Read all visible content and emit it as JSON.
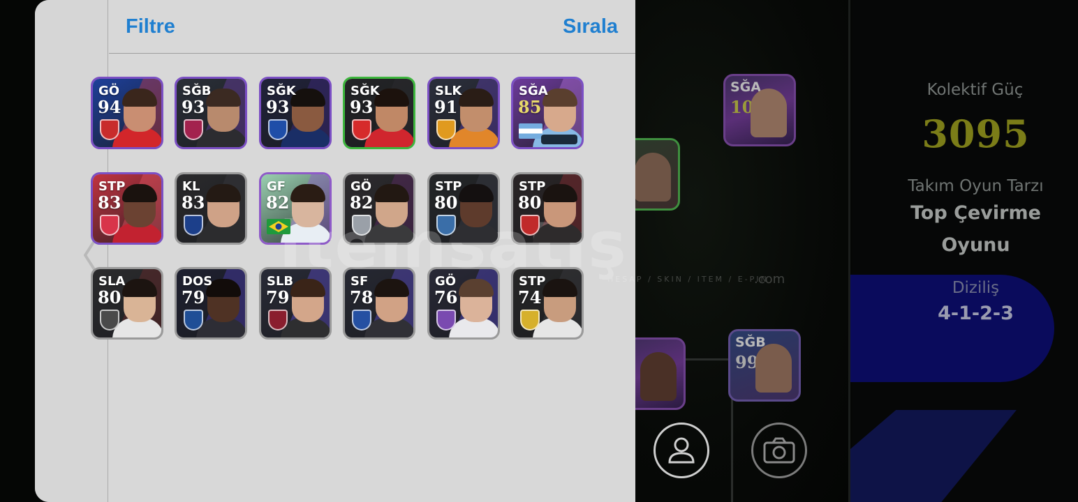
{
  "colors": {
    "panel_bg": "#d8d8d8",
    "accent_blue": "#1f7fd0",
    "collective_power": "#7b7d18"
  },
  "header": {
    "filter_label": "Filtre",
    "sort_label": "Sırala"
  },
  "players": [
    {
      "pos": "GÖ",
      "ovr": "94",
      "frame": "#7b4fc4",
      "bg": "#1d3f9a",
      "stripe": "#c43a4a",
      "crest": "#c82c2c",
      "skin": "#c98e72",
      "hair": "#3a261c",
      "kit": "#d2262a"
    },
    {
      "pos": "SĞB",
      "ovr": "93",
      "frame": "#7b4fc4",
      "bg": "#2a2f38",
      "stripe": "#6b3fa4",
      "crest": "#a3224e",
      "skin": "#b88a6d",
      "hair": "#3b2a22",
      "kit": "#2c2c30"
    },
    {
      "pos": "SĞK",
      "ovr": "93",
      "frame": "#7b4fc4",
      "bg": "#20223a",
      "stripe": "#3e2a80",
      "crest": "#1f4ea8",
      "skin": "#8a5a40",
      "hair": "#15100d",
      "kit": "#1a2e66"
    },
    {
      "pos": "SĞK",
      "ovr": "93",
      "frame": "#3db63d",
      "bg": "#232426",
      "stripe": "#2c2d30",
      "crest": "#d62b2b",
      "skin": "#c08866",
      "hair": "#1c120d",
      "kit": "#d0262e"
    },
    {
      "pos": "SLK",
      "ovr": "91",
      "frame": "#7b4fc4",
      "bg": "#2b2f3c",
      "stripe": "#5b3ea6",
      "crest": "#e09a1f",
      "skin": "#c28e6c",
      "hair": "#2a1d16",
      "kit": "#e1862a"
    },
    {
      "pos": "SĞA",
      "ovr": "85",
      "frame": "#7b4fc4",
      "bg": "#6c3a9a",
      "stripe": "#b06fd6",
      "crest": "#8fc6ee",
      "skin": "#d7a98c",
      "hair": "#5a3f2e",
      "kit": "#87b9e4",
      "flag": "argentina"
    },
    {
      "pos": "STP",
      "ovr": "83",
      "frame": "#7b4fc4",
      "bg": "#c23340",
      "stripe": "#e25562",
      "crest": "#d8344a",
      "skin": "#6b4232",
      "hair": "#1a120e",
      "kit": "#c22230"
    },
    {
      "pos": "KL",
      "ovr": "83",
      "frame": "#9a9a9a",
      "bg": "#2a2a2c",
      "stripe": "#3a3a3e",
      "crest": "#1c3f8a",
      "skin": "#cfa287",
      "hair": "#241a14",
      "kit": "#2c2c2e"
    },
    {
      "pos": "GF",
      "ovr": "82",
      "frame": "#8e5ac8",
      "bg": "#9ad0b0",
      "stripe": "#8e5ac8",
      "crest": "#22964a",
      "skin": "#d8b59e",
      "hair": "#2a1c14",
      "kit": "#e8eef4",
      "flag": "brazil"
    },
    {
      "pos": "GÖ",
      "ovr": "82",
      "frame": "#9a9a9a",
      "bg": "#2d2b2e",
      "stripe": "#5e2a64",
      "crest": "#9aa0a8",
      "skin": "#d0a68a",
      "hair": "#221812",
      "kit": "#3a3a3c"
    },
    {
      "pos": "STP",
      "ovr": "80",
      "frame": "#9a9a9a",
      "bg": "#242628",
      "stripe": "#3a3c46",
      "crest": "#3a6ea8",
      "skin": "#5e3b2c",
      "hair": "#141010",
      "kit": "#2e2e32"
    },
    {
      "pos": "STP",
      "ovr": "80",
      "frame": "#9a9a9a",
      "bg": "#2a2526",
      "stripe": "#8a2a30",
      "crest": "#c02a2a",
      "skin": "#c9977a",
      "hair": "#1a1310",
      "kit": "#2e2b2c"
    },
    {
      "pos": "SLA",
      "ovr": "80",
      "frame": "#9a9a9a",
      "bg": "#2b2b2d",
      "stripe": "#6a2a2a",
      "crest": "#4a4a4a",
      "skin": "#d9b496",
      "hair": "#1c1410",
      "kit": "#e6e6e6"
    },
    {
      "pos": "DOS",
      "ovr": "79",
      "frame": "#9a9a9a",
      "bg": "#1e2030",
      "stripe": "#4b3bb0",
      "crest": "#1f4e96",
      "skin": "#4f3224",
      "hair": "#120c0a",
      "kit": "#2d2d35"
    },
    {
      "pos": "SLB",
      "ovr": "79",
      "frame": "#9a9a9a",
      "bg": "#282a36",
      "stripe": "#5b4cc8",
      "crest": "#8a1e2e",
      "skin": "#d3a68a",
      "hair": "#3a2418",
      "kit": "#2e2e30"
    },
    {
      "pos": "SF",
      "ovr": "78",
      "frame": "#9a9a9a",
      "bg": "#262832",
      "stripe": "#5b4cc8",
      "crest": "#2550a2",
      "skin": "#d1a285",
      "hair": "#1c1410",
      "kit": "#303036"
    },
    {
      "pos": "GÖ",
      "ovr": "76",
      "frame": "#9a9a9a",
      "bg": "#282836",
      "stripe": "#4f45bf",
      "crest": "#7a4ab0",
      "skin": "#dbb39a",
      "hair": "#5a4030",
      "kit": "#e9e9ec"
    },
    {
      "pos": "STP",
      "ovr": "74",
      "frame": "#9a9a9a",
      "bg": "#262626",
      "stripe": "#3a3a3e",
      "crest": "#d6b02c",
      "skin": "#c89c7e",
      "hair": "#1a1310",
      "kit": "#e6e6e6"
    }
  ],
  "background": {
    "team_cards": [
      {
        "pos": "SĞA",
        "ovr": "101"
      },
      {
        "pos": "SĞB",
        "ovr": "99"
      }
    ],
    "stats": {
      "collective_label": "Kolektif Güç",
      "collective_value": "3095",
      "playstyle_label": "Takım Oyun Tarzı",
      "playstyle_line1": "Top Çevirme",
      "playstyle_line2": "Oyunu",
      "formation_label": "Diziliş",
      "formation_value": "4-1-2-3"
    },
    "icons": [
      "person-icon",
      "camera-icon"
    ]
  },
  "watermark": {
    "main": "itemsatış",
    "sub": "HESAP / SKIN / ITEM / E-PIN",
    "com": ".com"
  }
}
